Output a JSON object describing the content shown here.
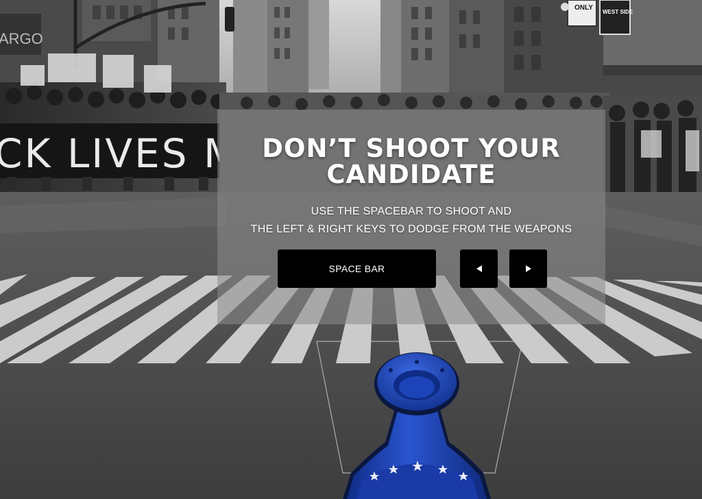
{
  "game": {
    "title_line1": "DON’T SHOOT YOUR",
    "title_line2": "CANDIDATE",
    "instructions_line1": "USE THE SPACEBAR TO SHOOT AND",
    "instructions_line2": "THE LEFT & RIGHT KEYS TO DODGE FROM THE WEAPONS"
  },
  "keys": {
    "space_label": "SPACE BAR",
    "left_icon": "left-arrow-icon",
    "right_icon": "right-arrow-icon"
  },
  "background": {
    "banner_text": "CK LIVES M",
    "sign_text": "ARGO",
    "street_sign_text": "WEST SIDE",
    "only_sign_text": "ONLY"
  },
  "colors": {
    "cannon_blue": "#1f46b8",
    "cannon_dark": "#0c1e66",
    "overlay": "#8c8c8c",
    "key_bg": "#000000"
  }
}
